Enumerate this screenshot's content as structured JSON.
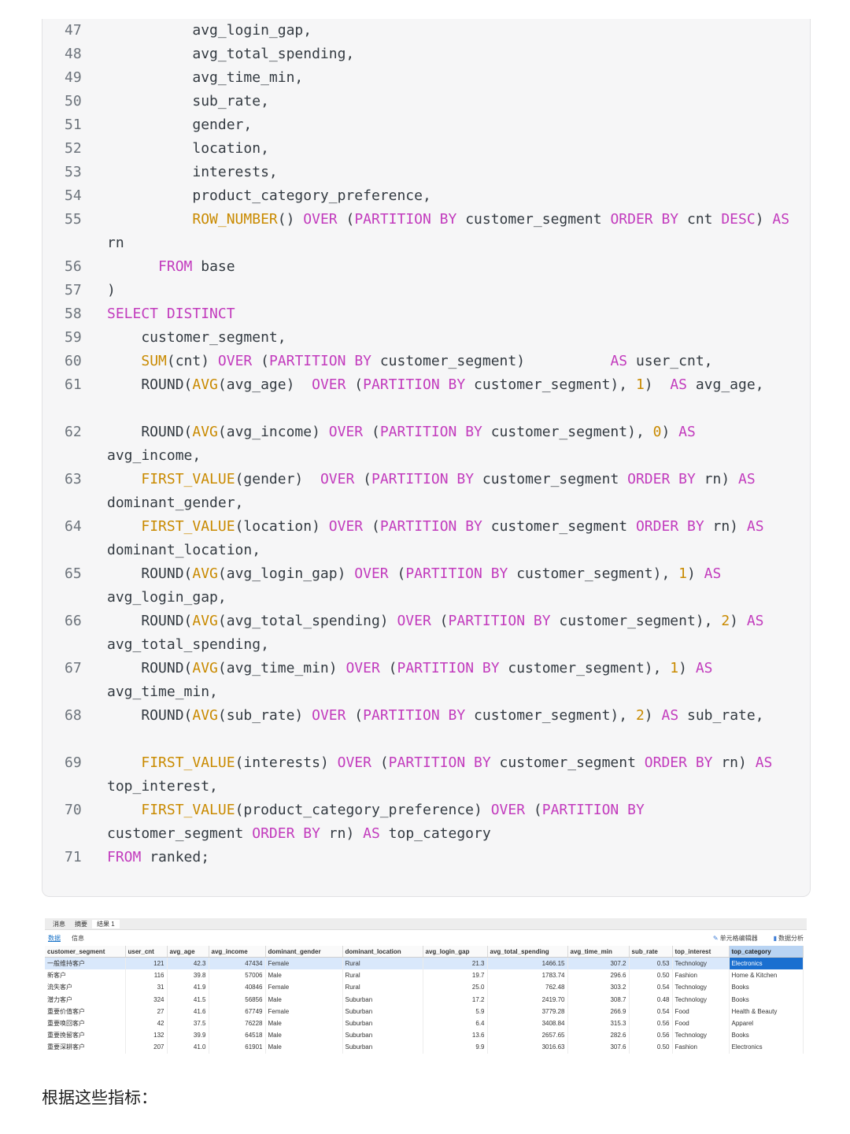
{
  "code": {
    "lines": [
      {
        "n": "47",
        "t": [
          [
            "          avg_login_gap,",
            ""
          ]
        ]
      },
      {
        "n": "48",
        "t": [
          [
            "          avg_total_spending,",
            ""
          ]
        ]
      },
      {
        "n": "49",
        "t": [
          [
            "          avg_time_min,",
            ""
          ]
        ]
      },
      {
        "n": "50",
        "t": [
          [
            "          sub_rate,",
            ""
          ]
        ]
      },
      {
        "n": "51",
        "t": [
          [
            "          gender,",
            ""
          ]
        ]
      },
      {
        "n": "52",
        "t": [
          [
            "          location,",
            ""
          ]
        ]
      },
      {
        "n": "53",
        "t": [
          [
            "          interests,",
            ""
          ]
        ]
      },
      {
        "n": "54",
        "t": [
          [
            "          product_category_preference,",
            ""
          ]
        ]
      },
      {
        "n": "55",
        "t": [
          [
            "          ",
            ""
          ],
          [
            "ROW_NUMBER",
            "fn"
          ],
          [
            "() ",
            ""
          ],
          [
            "OVER",
            "kw"
          ],
          [
            " (",
            ""
          ],
          [
            "PARTITION BY",
            "kw"
          ],
          [
            " customer_segment ",
            ""
          ],
          [
            "ORDER BY",
            "kw"
          ],
          [
            " cnt ",
            ""
          ],
          [
            "DESC",
            "kw"
          ],
          [
            ") ",
            ""
          ],
          [
            "AS",
            "kw"
          ]
        ]
      },
      {
        "n": "",
        "t": [
          [
            "rn",
            ""
          ]
        ],
        "wrap": true
      },
      {
        "n": "56",
        "t": [
          [
            "      ",
            ""
          ],
          [
            "FROM",
            "kw"
          ],
          [
            " base",
            ""
          ]
        ]
      },
      {
        "n": "57",
        "t": [
          [
            ")",
            ""
          ]
        ]
      },
      {
        "n": "58",
        "t": [
          [
            "SELECT DISTINCT",
            "kw"
          ]
        ]
      },
      {
        "n": "59",
        "t": [
          [
            "    customer_segment,",
            ""
          ]
        ]
      },
      {
        "n": "60",
        "t": [
          [
            "    ",
            ""
          ],
          [
            "SUM",
            "fn"
          ],
          [
            "(cnt) ",
            ""
          ],
          [
            "OVER",
            "kw"
          ],
          [
            " (",
            ""
          ],
          [
            "PARTITION BY",
            "kw"
          ],
          [
            " customer_segment)          ",
            ""
          ],
          [
            "AS",
            "kw"
          ],
          [
            " user_cnt,",
            ""
          ]
        ]
      },
      {
        "n": "61",
        "t": [
          [
            "    ROUND(",
            ""
          ],
          [
            "AVG",
            "fn"
          ],
          [
            "(avg_age)  ",
            ""
          ],
          [
            "OVER",
            "kw"
          ],
          [
            " (",
            ""
          ],
          [
            "PARTITION BY",
            "kw"
          ],
          [
            " customer_segment), ",
            ""
          ],
          [
            "1",
            "nm"
          ],
          [
            ")  ",
            ""
          ],
          [
            "AS",
            "kw"
          ],
          [
            " avg_age,",
            ""
          ]
        ]
      },
      {
        "n": "",
        "t": [
          [
            "",
            ""
          ]
        ],
        "blank": true
      },
      {
        "n": "62",
        "t": [
          [
            "    ROUND(",
            ""
          ],
          [
            "AVG",
            "fn"
          ],
          [
            "(avg_income) ",
            ""
          ],
          [
            "OVER",
            "kw"
          ],
          [
            " (",
            ""
          ],
          [
            "PARTITION BY",
            "kw"
          ],
          [
            " customer_segment), ",
            ""
          ],
          [
            "0",
            "nm"
          ],
          [
            ") ",
            ""
          ],
          [
            "AS",
            "kw"
          ]
        ]
      },
      {
        "n": "",
        "t": [
          [
            "avg_income,",
            ""
          ]
        ],
        "wrap": true
      },
      {
        "n": "63",
        "t": [
          [
            "    ",
            ""
          ],
          [
            "FIRST_VALUE",
            "fn"
          ],
          [
            "(gender)  ",
            ""
          ],
          [
            "OVER",
            "kw"
          ],
          [
            " (",
            ""
          ],
          [
            "PARTITION BY",
            "kw"
          ],
          [
            " customer_segment ",
            ""
          ],
          [
            "ORDER BY",
            "kw"
          ],
          [
            " rn) ",
            ""
          ],
          [
            "AS",
            "kw"
          ]
        ]
      },
      {
        "n": "",
        "t": [
          [
            "dominant_gender,",
            ""
          ]
        ],
        "wrap": true
      },
      {
        "n": "64",
        "t": [
          [
            "    ",
            ""
          ],
          [
            "FIRST_VALUE",
            "fn"
          ],
          [
            "(location) ",
            ""
          ],
          [
            "OVER",
            "kw"
          ],
          [
            " (",
            ""
          ],
          [
            "PARTITION BY",
            "kw"
          ],
          [
            " customer_segment ",
            ""
          ],
          [
            "ORDER BY",
            "kw"
          ],
          [
            " rn) ",
            ""
          ],
          [
            "AS",
            "kw"
          ]
        ]
      },
      {
        "n": "",
        "t": [
          [
            "dominant_location,",
            ""
          ]
        ],
        "wrap": true
      },
      {
        "n": "65",
        "t": [
          [
            "    ROUND(",
            ""
          ],
          [
            "AVG",
            "fn"
          ],
          [
            "(avg_login_gap) ",
            ""
          ],
          [
            "OVER",
            "kw"
          ],
          [
            " (",
            ""
          ],
          [
            "PARTITION BY",
            "kw"
          ],
          [
            " customer_segment), ",
            ""
          ],
          [
            "1",
            "nm"
          ],
          [
            ") ",
            ""
          ],
          [
            "AS",
            "kw"
          ]
        ]
      },
      {
        "n": "",
        "t": [
          [
            "avg_login_gap,",
            ""
          ]
        ],
        "wrap": true
      },
      {
        "n": "66",
        "t": [
          [
            "    ROUND(",
            ""
          ],
          [
            "AVG",
            "fn"
          ],
          [
            "(avg_total_spending) ",
            ""
          ],
          [
            "OVER",
            "kw"
          ],
          [
            " (",
            ""
          ],
          [
            "PARTITION BY",
            "kw"
          ],
          [
            " customer_segment), ",
            ""
          ],
          [
            "2",
            "nm"
          ],
          [
            ") ",
            ""
          ],
          [
            "AS",
            "kw"
          ]
        ]
      },
      {
        "n": "",
        "t": [
          [
            "avg_total_spending,",
            ""
          ]
        ],
        "wrap": true
      },
      {
        "n": "67",
        "t": [
          [
            "    ROUND(",
            ""
          ],
          [
            "AVG",
            "fn"
          ],
          [
            "(avg_time_min) ",
            ""
          ],
          [
            "OVER",
            "kw"
          ],
          [
            " (",
            ""
          ],
          [
            "PARTITION BY",
            "kw"
          ],
          [
            " customer_segment), ",
            ""
          ],
          [
            "1",
            "nm"
          ],
          [
            ") ",
            ""
          ],
          [
            "AS",
            "kw"
          ]
        ]
      },
      {
        "n": "",
        "t": [
          [
            "avg_time_min,",
            ""
          ]
        ],
        "wrap": true
      },
      {
        "n": "68",
        "t": [
          [
            "    ROUND(",
            ""
          ],
          [
            "AVG",
            "fn"
          ],
          [
            "(sub_rate) ",
            ""
          ],
          [
            "OVER",
            "kw"
          ],
          [
            " (",
            ""
          ],
          [
            "PARTITION BY",
            "kw"
          ],
          [
            " customer_segment), ",
            ""
          ],
          [
            "2",
            "nm"
          ],
          [
            ") ",
            ""
          ],
          [
            "AS",
            "kw"
          ],
          [
            " sub_rate,",
            ""
          ]
        ]
      },
      {
        "n": "",
        "t": [
          [
            "",
            ""
          ]
        ],
        "blank": true
      },
      {
        "n": "69",
        "t": [
          [
            "    ",
            ""
          ],
          [
            "FIRST_VALUE",
            "fn"
          ],
          [
            "(interests) ",
            ""
          ],
          [
            "OVER",
            "kw"
          ],
          [
            " (",
            ""
          ],
          [
            "PARTITION BY",
            "kw"
          ],
          [
            " customer_segment ",
            ""
          ],
          [
            "ORDER BY",
            "kw"
          ],
          [
            " rn) ",
            ""
          ],
          [
            "AS",
            "kw"
          ]
        ]
      },
      {
        "n": "",
        "t": [
          [
            "top_interest,",
            ""
          ]
        ],
        "wrap": true
      },
      {
        "n": "70",
        "t": [
          [
            "    ",
            ""
          ],
          [
            "FIRST_VALUE",
            "fn"
          ],
          [
            "(product_category_preference) ",
            ""
          ],
          [
            "OVER",
            "kw"
          ],
          [
            " (",
            ""
          ],
          [
            "PARTITION BY",
            "kw"
          ]
        ]
      },
      {
        "n": "",
        "t": [
          [
            "customer_segment ",
            ""
          ],
          [
            "ORDER BY",
            "kw"
          ],
          [
            " rn) ",
            ""
          ],
          [
            "AS",
            "kw"
          ],
          [
            " top_category",
            ""
          ]
        ],
        "wrap": true
      },
      {
        "n": "71",
        "t": [
          [
            "FROM",
            "kw"
          ],
          [
            " ranked;",
            ""
          ]
        ]
      }
    ]
  },
  "result_panel": {
    "top_tabs": [
      "消息",
      "摘要",
      "结果 1"
    ],
    "active_top_tab": 2,
    "sub_tabs": [
      "数据",
      "信息"
    ],
    "active_sub_tab": 0,
    "tools": [
      {
        "icon": "edit-icon",
        "label": "单元格编辑器"
      },
      {
        "icon": "chart-icon",
        "label": "数据分析"
      }
    ],
    "columns": [
      "customer_segment",
      "user_cnt",
      "avg_age",
      "avg_income",
      "dominant_gender",
      "dominant_location",
      "avg_login_gap",
      "avg_total_spending",
      "avg_time_min",
      "sub_rate",
      "top_interest",
      "top_category"
    ],
    "numeric": [
      false,
      true,
      true,
      true,
      false,
      false,
      true,
      true,
      true,
      true,
      false,
      false
    ],
    "rows": [
      [
        "一般维持客户",
        "121",
        "42.3",
        "47434",
        "Female",
        "Rural",
        "21.3",
        "1466.15",
        "307.2",
        "0.53",
        "Technology",
        "Electronics"
      ],
      [
        "新客户",
        "116",
        "39.8",
        "57006",
        "Male",
        "Rural",
        "19.7",
        "1783.74",
        "296.6",
        "0.50",
        "Fashion",
        "Home & Kitchen"
      ],
      [
        "流失客户",
        "31",
        "41.9",
        "40846",
        "Female",
        "Rural",
        "25.0",
        "762.48",
        "303.2",
        "0.54",
        "Technology",
        "Books"
      ],
      [
        "潜力客户",
        "324",
        "41.5",
        "56856",
        "Male",
        "Suburban",
        "17.2",
        "2419.70",
        "308.7",
        "0.48",
        "Technology",
        "Books"
      ],
      [
        "重要价值客户",
        "27",
        "41.6",
        "67749",
        "Female",
        "Suburban",
        "5.9",
        "3779.28",
        "266.9",
        "0.54",
        "Food",
        "Health & Beauty"
      ],
      [
        "重要唤回客户",
        "42",
        "37.5",
        "76228",
        "Male",
        "Suburban",
        "6.4",
        "3408.84",
        "315.3",
        "0.56",
        "Food",
        "Apparel"
      ],
      [
        "重要挽留客户",
        "132",
        "39.9",
        "64518",
        "Male",
        "Suburban",
        "13.6",
        "2657.65",
        "282.6",
        "0.56",
        "Technology",
        "Books"
      ],
      [
        "重要深耕客户",
        "207",
        "41.0",
        "61901",
        "Male",
        "Suburban",
        "9.9",
        "3016.63",
        "307.6",
        "0.50",
        "Fashion",
        "Electronics"
      ]
    ],
    "selected_row": 0
  },
  "footer": {
    "text": "根据这些指标："
  }
}
